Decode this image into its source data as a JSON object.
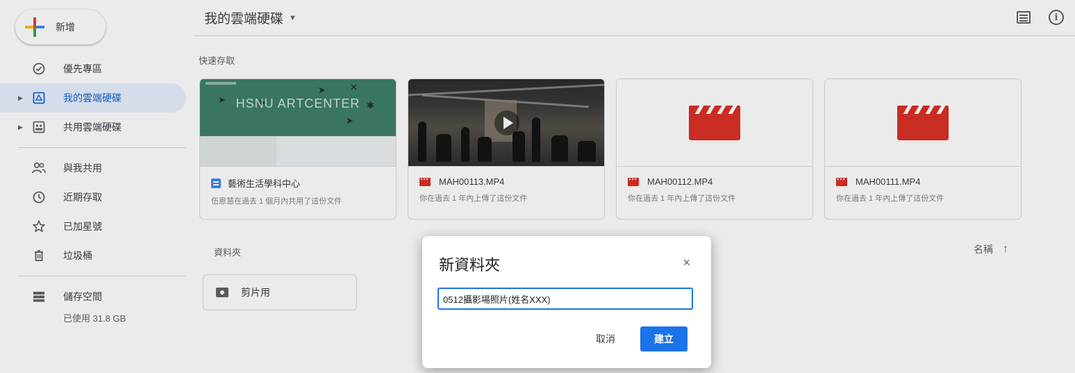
{
  "sidebar": {
    "new_button": "新增",
    "items": [
      {
        "label": "優先專區",
        "icon": "priority-icon",
        "caret": false,
        "active": false
      },
      {
        "label": "我的雲端硬碟",
        "icon": "my-drive-icon",
        "caret": true,
        "active": true
      },
      {
        "label": "共用雲端硬碟",
        "icon": "shared-drives-icon",
        "caret": true,
        "active": false
      },
      {
        "label": "與我共用",
        "icon": "shared-with-me-icon",
        "caret": false,
        "active": false
      },
      {
        "label": "近期存取",
        "icon": "recent-icon",
        "caret": false,
        "active": false
      },
      {
        "label": "已加星號",
        "icon": "star-icon",
        "caret": false,
        "active": false
      },
      {
        "label": "垃圾桶",
        "icon": "trash-icon",
        "caret": false,
        "active": false
      }
    ],
    "storage": {
      "label": "儲存空間",
      "used": "已使用 31.8 GB",
      "icon": "storage-icon"
    }
  },
  "header": {
    "breadcrumb": "我的雲端硬碟",
    "icons": [
      "list-view-icon",
      "info-icon"
    ]
  },
  "quick_access": {
    "title": "快速存取",
    "cards": [
      {
        "name": "藝術生活學科中心",
        "sub": "伍恩慧在過去 1 個月內共用了這份文件",
        "kind": "doc",
        "thumb_text": "HSNU ARTCENTER"
      },
      {
        "name": "MAH00113.MP4",
        "sub": "你在過去 1 年內上傳了這份文件",
        "kind": "video"
      },
      {
        "name": "MAH00112.MP4",
        "sub": "你在過去 1 年內上傳了這份文件",
        "kind": "clap"
      },
      {
        "name": "MAH00111.MP4",
        "sub": "你在過去 1 年內上傳了這份文件",
        "kind": "clap"
      }
    ]
  },
  "folders": {
    "title": "資料夾",
    "sort_label": "名稱",
    "sort_arrow": "↑",
    "items": [
      {
        "name": "剪片用"
      }
    ]
  },
  "dialog": {
    "title": "新資料夾",
    "close": "×",
    "input_value": "0512攝影場照片(姓名XXX)",
    "cancel": "取消",
    "create": "建立"
  },
  "colors": {
    "accent": "#1a73e8",
    "active_bg": "#e8f0fe",
    "video_red": "#d93025"
  }
}
